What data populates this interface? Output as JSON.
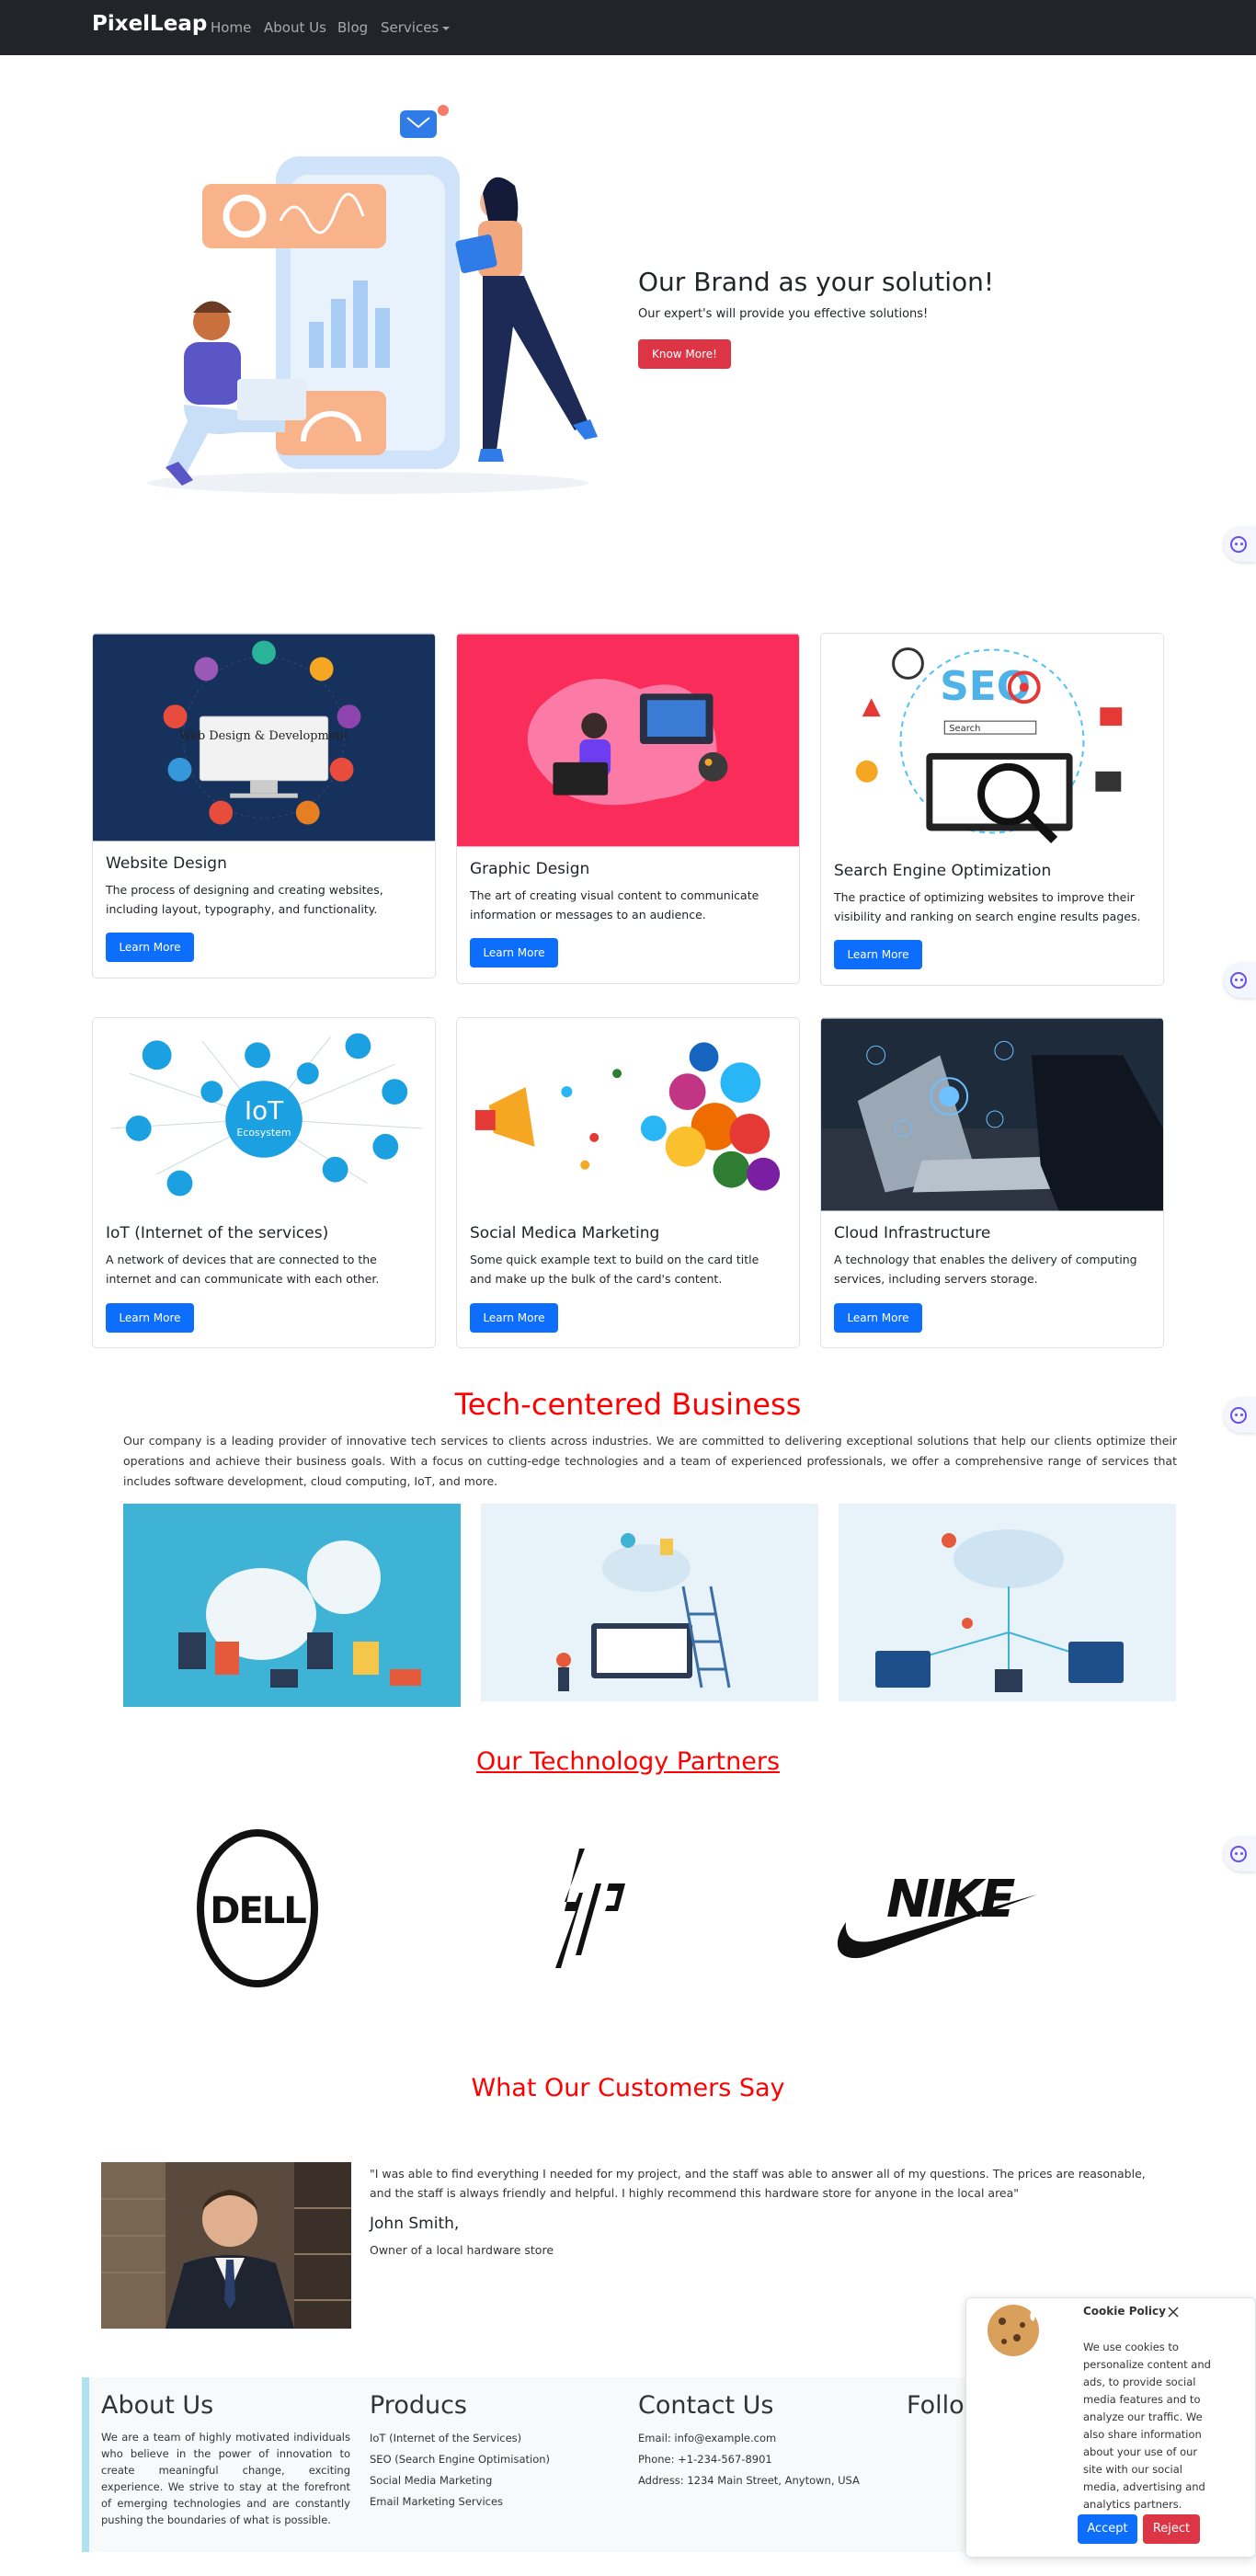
{
  "navbar": {
    "brand": "PixelLeap",
    "links": [
      "Home",
      "About Us",
      "Blog",
      "Services"
    ]
  },
  "hero": {
    "title": "Our Brand as your solution!",
    "subtitle": "Our expert's will provide you effective solutions!",
    "button": "Know More!"
  },
  "services": [
    {
      "title": "Website Design",
      "text": "The process of designing and creating websites, including layout, typography, and functionality.",
      "button": "Learn More",
      "image_label": "Web Design & Development"
    },
    {
      "title": "Graphic Design",
      "text": "The art of creating visual content to communicate information or messages to an audience.",
      "button": "Learn More"
    },
    {
      "title": "Search Engine Optimization",
      "text": "The practice of optimizing websites to improve their visibility and ranking on search engine results pages.",
      "button": "Learn More",
      "image_label": "SEO",
      "image_search": "Search"
    },
    {
      "title": "IoT (Internet of the services)",
      "text": "A network of devices that are connected to the internet and can communicate with each other.",
      "button": "Learn More",
      "image_label": "IoT",
      "image_sub": "Ecosystem"
    },
    {
      "title": "Social Medica Marketing",
      "text": "Some quick example text to build on the card title and make up the bulk of the card's content.",
      "button": "Learn More"
    },
    {
      "title": "Cloud Infrastructure",
      "text": "A technology that enables the delivery of computing services, including servers storage.",
      "button": "Learn More"
    }
  ],
  "tech": {
    "title": "Tech-centered Business",
    "paragraph": "Our company is a leading provider of innovative tech services to clients across industries. We are committed to delivering exceptional solutions that help our clients optimize their operations and achieve their business goals. With a focus on cutting-edge technologies and a team of experienced professionals, we offer a comprehensive range of services that includes software development, cloud computing, IoT, and more."
  },
  "partners": {
    "title": "Our Technology Partners",
    "logos": [
      "DELL",
      "hp",
      "NIKE"
    ]
  },
  "customers": {
    "title": "What Our Customers Say",
    "quote": "\"I was able to find everything I needed for my project, and the staff was able to answer all of my questions. The prices are reasonable, and the staff is always friendly and helpful. I highly recommend this hardware store for anyone in the local area\"",
    "name": "John Smith,",
    "role": "Owner of a local hardware store"
  },
  "footer": {
    "about_title": "About Us",
    "about_text": "We are a team of highly motivated individuals who believe in the power of innovation to create meaningful change, exciting experience. We strive to stay at the forefront of emerging technologies and are constantly pushing the boundaries of what is possible.",
    "products_title": "Producs",
    "products": [
      "IoT (Internet of the Services)",
      "SEO (Search Engine Optimisation)",
      "Social Media Marketing",
      "Email Marketing Services"
    ],
    "contact_title": "Contact Us",
    "contact": [
      "Email: info@example.com",
      "Phone: +1-234-567-8901",
      "Address: 1234 Main Street, Anytown, USA"
    ],
    "follow_title": "Follo"
  },
  "cookie": {
    "title": "Cookie Policy",
    "text": "We use cookies to personalize content and ads, to provide social media features and to analyze our traffic. We also share information about your use of our site with our social media, advertising and analytics partners.",
    "accept": "Accept",
    "reject": "Reject"
  },
  "colors": {
    "navbar": "#212529",
    "primary": "#0d6efd",
    "danger": "#dc3545",
    "heading_red": "#ff0000"
  }
}
